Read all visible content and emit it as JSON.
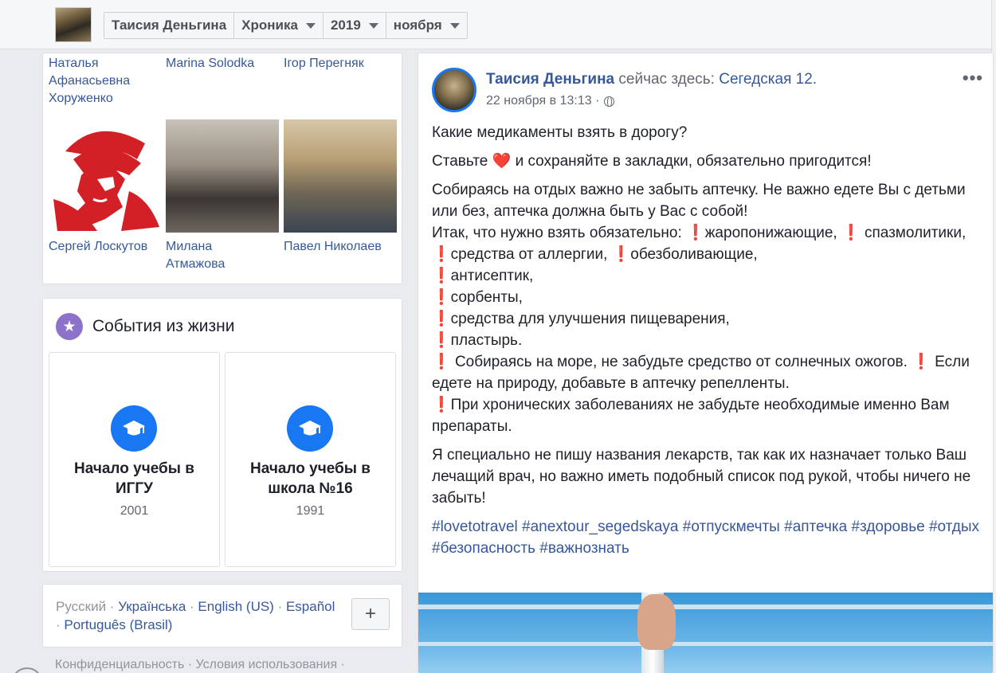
{
  "header": {
    "crumbs": [
      "Таисия Деньгина",
      "Хроника",
      "2019",
      "ноября"
    ]
  },
  "friends": {
    "top_names": [
      "Наталья Афанасьевна Хоруженко",
      "Marina Solodka",
      "Ігор Перегняк"
    ],
    "photo_names": [
      "Сергей Лоскутов",
      "Милана Атмажова",
      "Павел Николаев"
    ]
  },
  "events": {
    "title": "События из жизни",
    "items": [
      {
        "title": "Начало учебы в ИГГУ",
        "year": "2001"
      },
      {
        "title": "Начало учебы в школа №16",
        "year": "1991"
      }
    ]
  },
  "languages": {
    "current": "Русский",
    "links": [
      "Українська",
      "English (US)",
      "Español",
      "Português (Brasil)"
    ],
    "plus": "+"
  },
  "footer": {
    "links": "Конфиденциальность · Условия использования ·"
  },
  "post": {
    "author": "Таисия Деньгина",
    "here": "сейчас здесь:",
    "place": "Сегедская 12.",
    "time": "22 ноября в 13:13 ·",
    "more": "•••",
    "line1": "Какие медикаменты взять в дорогу?",
    "line2a": "Ставьте",
    "line2b": "и сохраняйте в закладки, обязательно пригодится!",
    "p3_1": "Собираясь на отдых важно не забыть аптечку. Не важно едете Вы с детьми или без, аптечка должна быть у Вас с собой!",
    "p3_2": "Итак, что нужно взять обязательно:",
    "p3_3": "жаропонижающие,",
    "p3_4": "спазмолитики,",
    "p3_5": "средства от аллергии,",
    "p3_6": "обезболивающие,",
    "p3_7": "антисептик,",
    "p3_8": "сорбенты,",
    "p3_9": "средства для улучшения пищеварения,",
    "p3_10": "пластырь.",
    "p3_11": "Собираясь на море, не забудьте средство от солнечных ожогов.",
    "p3_12": "Если едете на природу, добавьте в аптечку репелленты.",
    "p3_13": "При хронических заболеваниях не забудьте необходимые именно Вам препараты.",
    "p4": "Я специально не пишу названия лекарств, так как их назначает только Ваш лечащий врач, но важно иметь подобный список под рукой, чтобы ничего не забыть!",
    "hashtags": [
      "#lovetotravel",
      "#anextour_segedskaya",
      "#отпускмечты",
      "#аптечка",
      "#здоровье",
      "#отдых",
      "#безопасность",
      "#важнознать"
    ],
    "excl": "❗",
    "heart": "❤️"
  }
}
